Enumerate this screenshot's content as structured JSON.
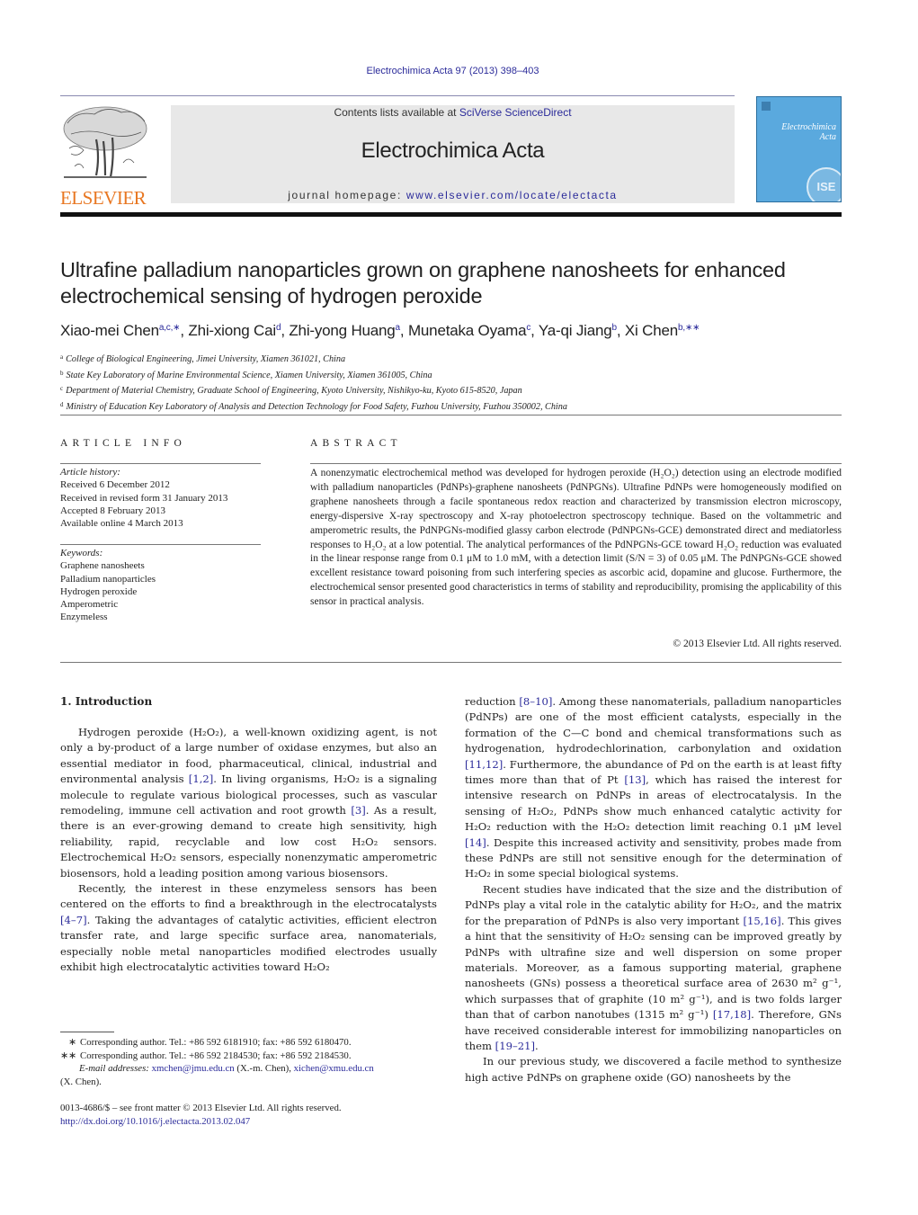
{
  "header": {
    "journal_ref": "Electrochimica Acta 97 (2013) 398–403",
    "contents_prefix": "Contents lists available at ",
    "contents_link": "SciVerse ScienceDirect",
    "journal_name": "Electrochimica Acta",
    "homepage_prefix": "journal homepage: ",
    "homepage_link": "www.elsevier.com/locate/electacta",
    "publisher_logo_text": "ELSEVIER",
    "cover_title_line1": "Electrochimica",
    "cover_title_line2": "Acta",
    "cover_seal_text": "ISE",
    "colors": {
      "link": "#2b2b9a",
      "elsevier_orange": "#e87722",
      "cover_blue": "#5aa9de",
      "banner_gray": "#e8e8e8"
    }
  },
  "article": {
    "title_line1": "Ultrafine palladium nanoparticles grown on graphene nanosheets for enhanced",
    "title_line2": "electrochemical sensing of hydrogen peroxide",
    "authors": [
      {
        "name": "Xiao-mei Chen",
        "sup": "a,c,∗"
      },
      {
        "name": "Zhi-xiong Cai",
        "sup": "d"
      },
      {
        "name": "Zhi-yong Huang",
        "sup": "a"
      },
      {
        "name": "Munetaka Oyama",
        "sup": "c"
      },
      {
        "name": "Ya-qi Jiang",
        "sup": "b"
      },
      {
        "name": "Xi Chen",
        "sup": "b,∗∗"
      }
    ],
    "affiliations": [
      {
        "key": "a",
        "text": "College of Biological Engineering, Jimei University, Xiamen 361021, China"
      },
      {
        "key": "b",
        "text": "State Key Laboratory of Marine Environmental Science, Xiamen University, Xiamen 361005, China"
      },
      {
        "key": "c",
        "text": "Department of Material Chemistry, Graduate School of Engineering, Kyoto University, Nishikyo-ku, Kyoto 615-8520, Japan"
      },
      {
        "key": "d",
        "text": "Ministry of Education Key Laboratory of Analysis and Detection Technology for Food Safety, Fuzhou University, Fuzhou 350002, China"
      }
    ]
  },
  "article_info": {
    "heading": "ARTICLE INFO",
    "history_label": "Article history:",
    "history": [
      "Received 6 December 2012",
      "Received in revised form 31 January 2013",
      "Accepted 8 February 2013",
      "Available online 4 March 2013"
    ],
    "keywords_label": "Keywords:",
    "keywords": [
      "Graphene nanosheets",
      "Palladium nanoparticles",
      "Hydrogen peroxide",
      "Amperometric",
      "Enzymeless"
    ]
  },
  "abstract": {
    "heading": "ABSTRACT",
    "text": "A nonenzymatic electrochemical method was developed for hydrogen peroxide (H₂O₂) detection using an electrode modified with palladium nanoparticles (PdNPs)-graphene nanosheets (PdNPGNs). Ultrafine PdNPs were homogeneously modified on graphene nanosheets through a facile spontaneous redox reaction and characterized by transmission electron microscopy, energy-dispersive X-ray spectroscopy and X-ray photoelectron spectroscopy technique. Based on the voltammetric and amperometric results, the PdNPGNs-modified glassy carbon electrode (PdNPGNs-GCE) demonstrated direct and mediatorless responses to H₂O₂ at a low potential. The analytical performances of the PdNPGNs-GCE toward H₂O₂ reduction was evaluated in the linear response range from 0.1 μM to 1.0 mM, with a detection limit (S/N = 3) of 0.05 μM. The PdNPGNs-GCE showed excellent resistance toward poisoning from such interfering species as ascorbic acid, dopamine and glucose. Furthermore, the electrochemical sensor presented good characteristics in terms of stability and reproducibility, promising the applicability of this sensor in practical analysis.",
    "copyright": "© 2013 Elsevier Ltd. All rights reserved."
  },
  "introduction": {
    "heading": "1.  Introduction",
    "left_col": [
      [
        {
          "t": "Hydrogen peroxide (H₂O₂), a well-known oxidizing agent, is not only a by-product of a large number of oxidase enzymes, but also an essential mediator in food, pharmaceutical, clinical, industrial and environmental analysis "
        },
        {
          "t": "[1,2]",
          "link": true
        },
        {
          "t": ". In living organisms, H₂O₂ is a signaling molecule to regulate various biological processes, such as vascular remodeling, immune cell activation and root growth "
        },
        {
          "t": "[3]",
          "link": true
        },
        {
          "t": ". As a result, there is an ever-growing demand to create high sensitivity, high reliability, rapid, recyclable and low cost H₂O₂ sensors. Electrochemical H₂O₂ sensors, especially nonenzymatic amperometric biosensors, hold a leading position among various biosensors."
        }
      ],
      [
        {
          "t": "Recently, the interest in these enzymeless sensors has been centered on the efforts to find a breakthrough in the electrocatalysts "
        },
        {
          "t": "[4–7]",
          "link": true
        },
        {
          "t": ". Taking the advantages of catalytic activities, efficient electron transfer rate, and large specific surface area, nanomaterials, especially noble metal nanoparticles modified electrodes usually exhibit high electrocatalytic activities toward H₂O₂"
        }
      ]
    ],
    "right_col": [
      [
        {
          "t": "reduction "
        },
        {
          "t": "[8–10]",
          "link": true
        },
        {
          "t": ". Among these nanomaterials, palladium nanoparticles (PdNPs) are one of the most efficient catalysts, especially in the formation of the C—C bond and chemical transformations such as hydrogenation, hydrodechlorination, carbonylation and oxidation "
        },
        {
          "t": "[11,12]",
          "link": true
        },
        {
          "t": ". Furthermore, the abundance of Pd on the earth is at least fifty times more than that of Pt "
        },
        {
          "t": "[13]",
          "link": true
        },
        {
          "t": ", which has raised the interest for intensive research on PdNPs in areas of electrocatalysis. In the sensing of H₂O₂, PdNPs show much enhanced catalytic activity for H₂O₂ reduction with the H₂O₂ detection limit reaching 0.1 μM level "
        },
        {
          "t": "[14]",
          "link": true
        },
        {
          "t": ". Despite this increased activity and sensitivity, probes made from these PdNPs are still not sensitive enough for the determination of H₂O₂ in some special biological systems."
        }
      ],
      [
        {
          "t": "Recent studies have indicated that the size and the distribution of PdNPs play a vital role in the catalytic ability for H₂O₂, and the matrix for the preparation of PdNPs is also very important "
        },
        {
          "t": "[15,16]",
          "link": true
        },
        {
          "t": ". This gives a hint that the sensitivity of H₂O₂ sensing can be improved greatly by PdNPs with ultrafine size and well dispersion on some proper materials. Moreover, as a famous supporting material, graphene nanosheets (GNs) possess a theoretical surface area of 2630 m² g⁻¹, which surpasses that of graphite (10 m² g⁻¹), and is two folds larger than that of carbon nanotubes (1315 m² g⁻¹) "
        },
        {
          "t": "[17,18]",
          "link": true
        },
        {
          "t": ". Therefore, GNs have received considerable interest for immobilizing nanoparticles on them "
        },
        {
          "t": "[19–21]",
          "link": true
        },
        {
          "t": "."
        }
      ],
      [
        {
          "t": "In our previous study, we discovered a facile method to synthesize high active PdNPs on graphene oxide (GO) nanosheets by the"
        }
      ]
    ]
  },
  "footnotes": {
    "corr1_mark": "∗",
    "corr1": "Corresponding author. Tel.: +86 592 6181910; fax: +86 592 6180470.",
    "corr2_mark": "∗∗",
    "corr2": "Corresponding author. Tel.: +86 592 2184530; fax: +86 592 2184530.",
    "email_label": "E-mail addresses:",
    "email1": "xmchen@jmu.edu.cn",
    "email1_who": " (X.-m. Chen), ",
    "email2": "xichen@xmu.edu.cn",
    "email2_who": "(X. Chen).",
    "issn": "0013-4686/$ – see front matter © 2013 Elsevier Ltd. All rights reserved.",
    "doi": "http://dx.doi.org/10.1016/j.electacta.2013.02.047"
  }
}
